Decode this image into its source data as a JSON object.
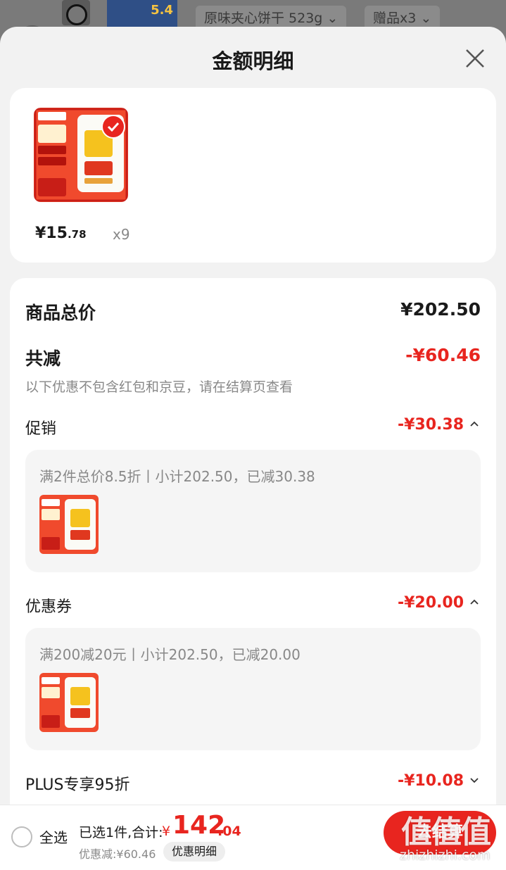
{
  "background": {
    "spec_chip": "原味夹心饼干 523g",
    "gift_chip": "赠品x3",
    "product_badge": "5.4"
  },
  "sheet": {
    "title": "金额明细"
  },
  "product": {
    "price_main": "¥15",
    "price_dec": ".78",
    "quantity": "x9",
    "image_icon": "biscuit-product-image"
  },
  "summary": {
    "total_label": "商品总价",
    "total_value": "¥202.50",
    "reduce_label": "共减",
    "reduce_value": "-¥60.46",
    "reduce_note": "以下优惠不包含红包和京豆，请在结算页查看"
  },
  "discounts": [
    {
      "label": "促销",
      "value": "-¥30.38",
      "detail": "满2件总价8.5折丨小计202.50，已减30.38",
      "expanded": true
    },
    {
      "label": "优惠券",
      "value": "-¥20.00",
      "detail": "满200减20元丨小计202.50，已减20.00",
      "expanded": true
    },
    {
      "label": "PLUS专享95折",
      "value": "-¥10.08",
      "expanded": false
    }
  ],
  "bottom_bar": {
    "select_all": "全选",
    "selected_text": "已选1件,合计:",
    "total_currency": "¥",
    "total_int": "142",
    "total_dec": ".04",
    "discount_text": "优惠减:¥60.46",
    "discount_detail_button": "优惠明细",
    "checkout_button": "去结算"
  },
  "watermark": {
    "big": "值值值",
    "small": "zhizhizhi.com"
  },
  "colors": {
    "accent_red": "#e8251f",
    "sheet_bg": "#f2f2f2",
    "card_bg": "#ffffff",
    "muted_text": "#888888"
  }
}
